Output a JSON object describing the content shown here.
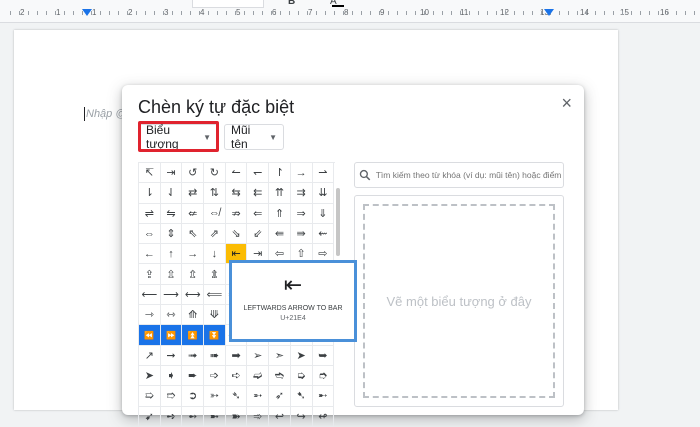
{
  "ruler": {
    "left_nums": [
      "2",
      "1",
      "1",
      "2",
      "3",
      "4",
      "5",
      "6",
      "7",
      "8",
      "9"
    ],
    "right_nums": [
      "10",
      "11",
      "12",
      "13",
      "14",
      "15",
      "16"
    ]
  },
  "toolbar": {
    "bold": "B",
    "font_color": "A"
  },
  "document": {
    "placeholder": "Nhập @"
  },
  "dialog": {
    "title": "Chèn ký tự đặc biệt",
    "close": "×",
    "category_dropdown": "Biểu tượng",
    "subcategory_dropdown": "Mũi tên",
    "search_placeholder": "Tìm kiếm theo từ khóa (ví dụ: mũi tên) hoặc điểm...",
    "draw_hint": "Vẽ một biểu tượng ở đây",
    "grid": [
      [
        "↸",
        "⇥",
        "↺",
        "↻",
        "↼",
        "↽",
        "↾",
        "→",
        "⇀"
      ],
      [
        "⇂",
        "⇃",
        "⇄",
        "⇅",
        "⇆",
        "⇇",
        "⇈",
        "⇉",
        "⇊"
      ],
      [
        "⇌",
        "⇋",
        "⇍",
        "⇎",
        "⇏",
        "⇐",
        "⇑",
        "⇒",
        "⇓"
      ],
      [
        "⇔",
        "⇕",
        "⇖",
        "⇗",
        "⇘",
        "⇙",
        "⇚",
        "⇛",
        "⇜"
      ],
      [
        "←",
        "↑",
        "→",
        "↓",
        "⇤",
        "⇥",
        "⇦",
        "⇧",
        "⇨"
      ],
      [
        "⇪",
        "⇫",
        "⇬",
        "⇭",
        "⇮",
        "⇯",
        "⇰",
        "⇱",
        "⇲"
      ],
      [
        "⟵",
        "⟶",
        "⟷",
        "⟸",
        "⟹",
        "⟺",
        "⟻",
        "⟼",
        "⟽"
      ],
      [
        "⇾",
        "⇿",
        "⟰",
        "⟱",
        "⟲",
        "⟳",
        "⟴",
        "⟶",
        "⟷"
      ],
      [
        "⏪",
        "⏩",
        "⏫",
        "⏬",
        "⟸",
        "⟹",
        "⟺",
        "⟻",
        "⟼"
      ],
      [
        "↗",
        "➞",
        "➟",
        "➠",
        "➡",
        "➢",
        "➣",
        "➤",
        "➥"
      ],
      [
        "➤",
        "➧",
        "➨",
        "➩",
        "➪",
        "➫",
        "➬",
        "➭",
        "➮"
      ],
      [
        "➯",
        "➱",
        "➲",
        "➳",
        "➴",
        "➵",
        "➶",
        "➷",
        "➸"
      ],
      [
        "➹",
        "➺",
        "➻",
        "➼",
        "➽",
        "➾",
        "↩",
        "↪",
        "↫"
      ]
    ],
    "selected": {
      "glyph": "⇤",
      "name": "LEFTWARDS ARROW TO BAR",
      "code": "U+21E4"
    },
    "colors": {
      "accent_highlight": "#fbbc04",
      "red_outline": "#e0232e",
      "blue_outline": "#4a90d9"
    }
  }
}
